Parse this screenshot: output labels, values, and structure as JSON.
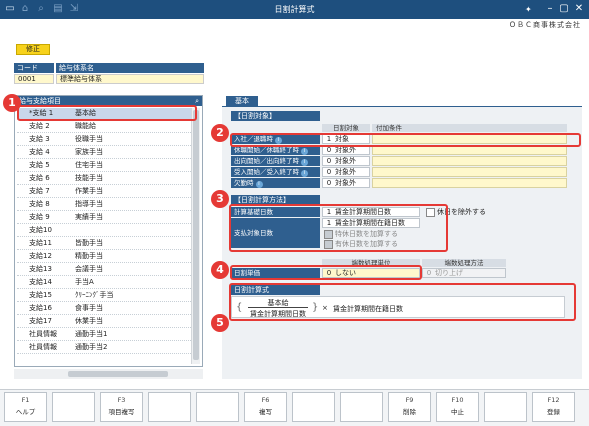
{
  "window": {
    "title": "日割計算式",
    "company": "ＯＢＣ商事株式会社"
  },
  "mode_label": "修正",
  "code_table": {
    "headers": [
      "コード",
      "給与体系名"
    ],
    "code": "0001",
    "name": "標準給与体系"
  },
  "left_panel": {
    "title": "給与支給項目",
    "items": [
      {
        "code": "*支給 1",
        "name": "基本給"
      },
      {
        "code": "支給 2",
        "name": "職能給"
      },
      {
        "code": "支給 3",
        "name": "役職手当"
      },
      {
        "code": "支給 4",
        "name": "家族手当"
      },
      {
        "code": "支給 5",
        "name": "住宅手当"
      },
      {
        "code": "支給 6",
        "name": "技能手当"
      },
      {
        "code": "支給 7",
        "name": "作業手当"
      },
      {
        "code": "支給 8",
        "name": "指導手当"
      },
      {
        "code": "支給 9",
        "name": "実績手当"
      },
      {
        "code": "支給10",
        "name": ""
      },
      {
        "code": "支給11",
        "name": "皆勤手当"
      },
      {
        "code": "支給12",
        "name": "精勤手当"
      },
      {
        "code": "支給13",
        "name": "会議手当"
      },
      {
        "code": "支給14",
        "name": "手当A"
      },
      {
        "code": "支給15",
        "name": "ｸﾘｰﾆﾝｸﾞ手当"
      },
      {
        "code": "支給16",
        "name": "食事手当"
      },
      {
        "code": "支給17",
        "name": "休業手当"
      },
      {
        "code": "社員情報",
        "name": "通勤手当1"
      },
      {
        "code": "社員情報",
        "name": "通勤手当2"
      }
    ]
  },
  "tab": {
    "label": "基本"
  },
  "section1": {
    "title": "【日割対象】",
    "col_target": "日割対象",
    "col_condition": "付加条件",
    "rows": [
      {
        "label": "入社／退職時",
        "num": "1",
        "value": "対象"
      },
      {
        "label": "休職開始／休職終了時",
        "num": "0",
        "value": "対象外"
      },
      {
        "label": "出向開始／出向終了時",
        "num": "0",
        "value": "対象外"
      },
      {
        "label": "受入開始／受入終了時",
        "num": "0",
        "value": "対象外"
      },
      {
        "label": "欠勤時",
        "num": "0",
        "value": "対象外"
      }
    ]
  },
  "section2": {
    "title": "【日割計算方法】",
    "basis_label": "計算基礎日数",
    "basis_num": "1",
    "basis_value": "賃金計算期間日数",
    "exclude_holiday": "休日を除外する",
    "target_label": "支払対象日数",
    "target_num": "1",
    "target_value": "賃金計算期間在籍日数",
    "special_leave": "特休日数を加算する",
    "paid_leave": "有休日数を加算する"
  },
  "section3": {
    "col_unit": "端数処理単位",
    "col_method": "端数処理方法",
    "label": "日割単価",
    "unit_num": "0",
    "unit_value": "しない",
    "method_num": "0",
    "method_value": "切り上げ"
  },
  "formula": {
    "title": "日割計算式",
    "numerator": "基本給",
    "denominator": "賃金計算期間日数",
    "times": "×",
    "right": "賃金計算期間在籍日数"
  },
  "fkeys": [
    {
      "key": "F1",
      "label": "ヘルプ"
    },
    {
      "key": "",
      "label": ""
    },
    {
      "key": "F3",
      "label": "項目複写"
    },
    {
      "key": "",
      "label": ""
    },
    {
      "key": "",
      "label": ""
    },
    {
      "key": "F6",
      "label": "複写"
    },
    {
      "key": "",
      "label": ""
    },
    {
      "key": "",
      "label": ""
    },
    {
      "key": "F9",
      "label": "削除"
    },
    {
      "key": "F10",
      "label": "中止"
    },
    {
      "key": "",
      "label": ""
    },
    {
      "key": "F12",
      "label": "登録"
    }
  ],
  "badges": [
    "1",
    "2",
    "3",
    "4",
    "5"
  ]
}
